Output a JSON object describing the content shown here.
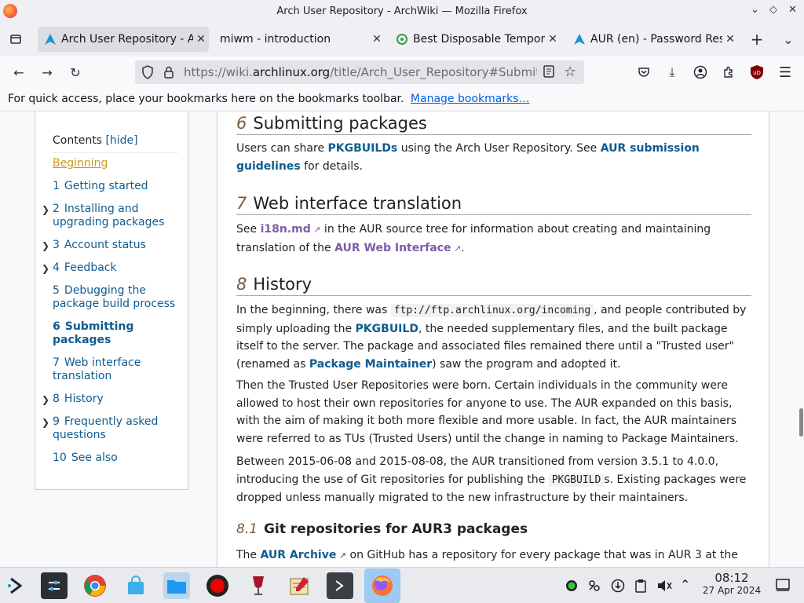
{
  "window": {
    "title": "Arch User Repository - ArchWiki — Mozilla Firefox"
  },
  "tabs": [
    {
      "label": "Arch User Repository - Ar",
      "icon": "arch-icon",
      "active": true
    },
    {
      "label": "miwm - introduction",
      "icon": "none",
      "active": false
    },
    {
      "label": "Best Disposable Tempora",
      "icon": "green-circle-icon",
      "active": false
    },
    {
      "label": "AUR (en) - Password Res",
      "icon": "arch-icon",
      "active": false
    }
  ],
  "url": {
    "prefix": "https://wiki.",
    "domain": "archlinux.org",
    "path": "/title/Arch_User_Repository#Submitting"
  },
  "bookmarks_bar": {
    "text": "For quick access, place your bookmarks here on the bookmarks toolbar.",
    "link": "Manage bookmarks…"
  },
  "toc": {
    "title": "Contents",
    "hide": "[hide]",
    "items": [
      {
        "num": "",
        "label": "Beginning"
      },
      {
        "num": "1",
        "label": "Getting started"
      },
      {
        "num": "2",
        "label": "Installing and upgrading packages"
      },
      {
        "num": "3",
        "label": "Account status"
      },
      {
        "num": "4",
        "label": "Feedback"
      },
      {
        "num": "5",
        "label": "Debugging the package build process"
      },
      {
        "num": "6",
        "label": "Submitting packages"
      },
      {
        "num": "7",
        "label": "Web interface translation"
      },
      {
        "num": "8",
        "label": "History"
      },
      {
        "num": "9",
        "label": "Frequently asked questions"
      },
      {
        "num": "10",
        "label": "See also"
      }
    ]
  },
  "article": {
    "s6": {
      "num": "6",
      "title": "Submitting packages",
      "p_a": "Users can share ",
      "link1": "PKGBUILDs",
      "p_b": " using the Arch User Repository. See ",
      "link2": "AUR submission guidelines",
      "p_c": " for details."
    },
    "s7": {
      "num": "7",
      "title": "Web interface translation",
      "p_a": "See ",
      "link1": "i18n.md",
      "p_b": " in the AUR source tree for information about creating and maintaining translation of the ",
      "link2": "AUR Web Interface",
      "p_c": "."
    },
    "s8": {
      "num": "8",
      "title": "History",
      "p1_a": "In the beginning, there was ",
      "p1_code": "ftp://ftp.archlinux.org/incoming",
      "p1_b": ", and people contributed by simply uploading the ",
      "p1_link1": "PKGBUILD",
      "p1_c": ", the needed supplementary files, and the built package itself to the server. The package and associated files remained there until a \"Trusted user\" (renamed as ",
      "p1_link2": "Package Maintainer",
      "p1_d": ") saw the program and adopted it.",
      "p2": "Then the Trusted User Repositories were born. Certain individuals in the community were allowed to host their own repositories for anyone to use. The AUR expanded on this basis, with the aim of making it both more flexible and more usable. In fact, the AUR maintainers were referred to as TUs (Trusted Users) until the change in naming to Package Maintainers.",
      "p3_a": "Between 2015-06-08 and 2015-08-08, the AUR transitioned from version 3.5.1 to 4.0.0, introducing the use of Git repositories for publishing the ",
      "p3_code": "PKGBUILD",
      "p3_b": "s. Existing packages were dropped unless manually migrated to the new infrastructure by their maintainers."
    },
    "s81": {
      "num": "8.1",
      "title": "Git repositories for AUR3 packages",
      "p_a": "The ",
      "link1": "AUR Archive",
      "p_b": " on GitHub has a repository for every package that was in AUR 3 at the"
    }
  },
  "clock": {
    "time": "08:12",
    "date": "27 Apr 2024"
  },
  "colors": {
    "link": "#0f5c8f",
    "ext_link": "#7b5ea7",
    "heading_num": "#7a5c3c",
    "beginning": "#c59c1a"
  }
}
